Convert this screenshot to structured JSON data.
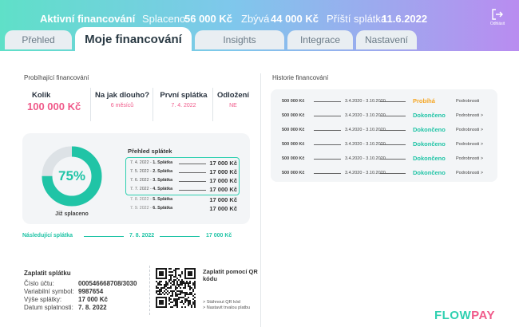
{
  "colors": {
    "accent": "#20c4a6",
    "pink": "#f05a8a",
    "orange": "#f5a623"
  },
  "header": {
    "active_label": "Aktivní financování",
    "paid_label": "Splaceno",
    "paid_value": "56 000 Kč",
    "remaining_label": "Zbývá",
    "remaining_value": "44 000 Kč",
    "next_label": "Příští splátka",
    "next_value": "11.6.2022",
    "logout_label": "Odhlásit"
  },
  "tabs": [
    "Přehled",
    "Moje financování",
    "Insights",
    "Integrace",
    "Nastavení"
  ],
  "current": {
    "title": "Probíhající financování",
    "amount_label": "Kolik",
    "amount_value": "100 000 Kč",
    "duration_label": "Na jak dlouho?",
    "duration_value": "6 měsíců",
    "first_label": "První splátka",
    "first_value": "7. 4. 2022",
    "defer_label": "Odložení",
    "defer_value": "NE"
  },
  "progress": {
    "percent_label": "75%",
    "fraction": 0.75,
    "caption": "Již splaceno"
  },
  "plan": {
    "title": "Přehled splátek",
    "rows": [
      {
        "date": "7. 4. 2022 - ",
        "name": "1. Splátka",
        "amount": "17 000 Kč",
        "paid": true
      },
      {
        "date": "7. 5. 2022 - ",
        "name": "2. Splátka",
        "amount": "17 000 Kč",
        "paid": true
      },
      {
        "date": "7. 6. 2022 - ",
        "name": "3. Splátka",
        "amount": "17 000 Kč",
        "paid": true
      },
      {
        "date": "7. 7. 2022 - ",
        "name": "4. Splátka",
        "amount": "17 000 Kč",
        "paid": true
      },
      {
        "date": "7. 8. 2022 - ",
        "name": "5. Splátka",
        "amount": "17 000 Kč",
        "paid": false
      },
      {
        "date": "7. 9. 2022 - ",
        "name": "6. Splátka",
        "amount": "17 000 Kč",
        "paid": false
      }
    ]
  },
  "next_payment": {
    "label": "Následující splátka",
    "date": "7. 8. 2022",
    "amount": "17 000 Kč"
  },
  "pay": {
    "title": "Zaplatit splátku",
    "rows": [
      {
        "k": "Číslo účtu:",
        "v": "000546668708/3030"
      },
      {
        "k": "Variabilní symbol:",
        "v": "9987654"
      },
      {
        "k": "Výše splátky:",
        "v": "17 000 Kč"
      },
      {
        "k": "Datum splatnosti:",
        "v": "7. 8. 2022"
      }
    ],
    "qr_title": "Zaplatit pomocí QR kódu",
    "qr_download": "> Stáhnout QR kód",
    "qr_standing": "> Nastavit trvalou platbu"
  },
  "history": {
    "title": "Historie financování",
    "rows": [
      {
        "amount": "500 000 Kč",
        "period": "3.4.2020 - 3.10.2020",
        "status": "Probíhá",
        "ongoing": true,
        "detail": "Podrobnosti"
      },
      {
        "amount": "500 000 Kč",
        "period": "3.4.2020 - 3.10.2020",
        "status": "Dokončeno",
        "ongoing": false,
        "detail": "Podrobnosti >"
      },
      {
        "amount": "500 000 Kč",
        "period": "3.4.2020 - 3.10.2020",
        "status": "Dokončeno",
        "ongoing": false,
        "detail": "Podrobnosti >"
      },
      {
        "amount": "500 000 Kč",
        "period": "3.4.2020 - 3.10.2020",
        "status": "Dokončeno",
        "ongoing": false,
        "detail": "Podrobnosti >"
      },
      {
        "amount": "500 000 Kč",
        "period": "3.4.2020 - 3.10.2020",
        "status": "Dokončeno",
        "ongoing": false,
        "detail": "Podrobnosti >"
      },
      {
        "amount": "500 000 Kč",
        "period": "3.4.2020 - 3.10.2020",
        "status": "Dokončeno",
        "ongoing": false,
        "detail": "Podrobnosti >"
      }
    ]
  },
  "brand": {
    "name": "FLOWPAY"
  }
}
